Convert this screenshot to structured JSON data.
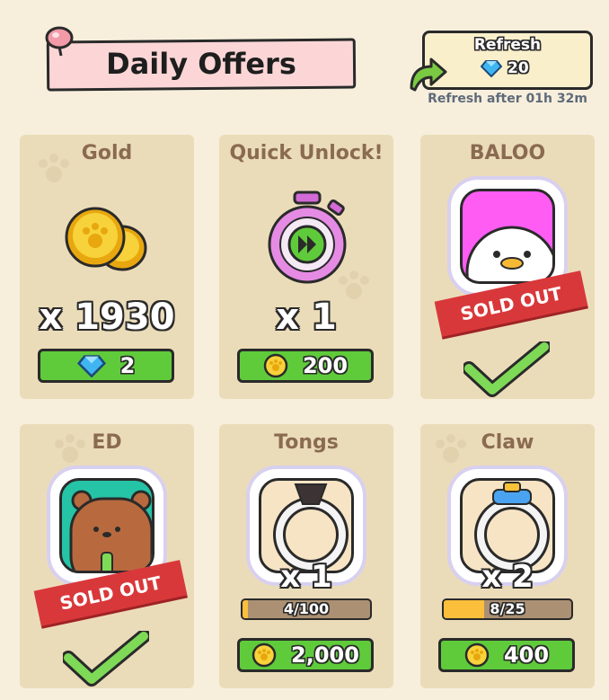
{
  "header": {
    "title": "Daily Offers",
    "refresh_label": "Refresh",
    "refresh_cost": "20",
    "refresh_timer": "Refresh after 01h 32m"
  },
  "offers": [
    {
      "title": "Gold",
      "quantity": "x 1930",
      "price": "2",
      "currency_icon": "gem-icon",
      "status": "available"
    },
    {
      "title": "Quick Unlock!",
      "quantity": "x 1",
      "price": "200",
      "currency_icon": "coin-icon",
      "status": "available"
    },
    {
      "title": "BALOO",
      "sold_label": "SOLD OUT",
      "status": "sold-out"
    },
    {
      "title": "ED",
      "sold_label": "SOLD OUT",
      "status": "sold-out"
    },
    {
      "title": "Tongs",
      "quantity": "x 1",
      "progress_text": "4/100",
      "progress": 0.04,
      "price": "2,000",
      "currency_icon": "coin-icon",
      "status": "available"
    },
    {
      "title": "Claw",
      "quantity": "x 2",
      "progress_text": "8/25",
      "progress": 0.32,
      "price": "400",
      "currency_icon": "coin-icon",
      "status": "available"
    }
  ],
  "colors": {
    "background": "#f7efdc",
    "card": "#ebdcb9",
    "button_green": "#5fcb3b",
    "sold_red": "#d9383b",
    "title_pink": "#fcd6d6"
  }
}
